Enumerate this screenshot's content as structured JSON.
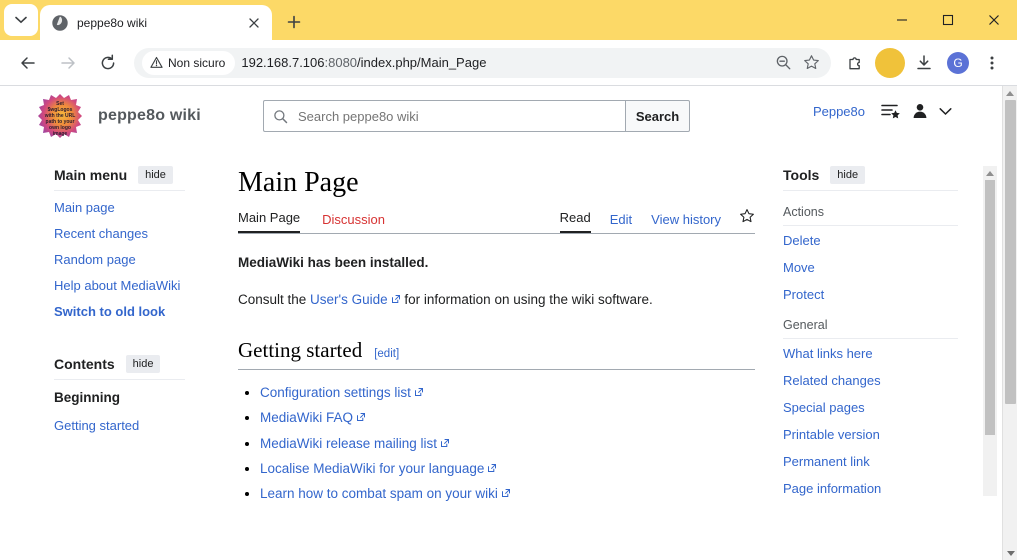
{
  "browser": {
    "tab": {
      "title": "peppe8o wiki",
      "favicon": "globe-icon",
      "close": "×"
    },
    "newtab_label": "+",
    "window_controls": {
      "minimize": "—",
      "maximize": "▢",
      "close": "✕"
    },
    "nav": {
      "back": "←",
      "forward": "→",
      "reload": "⟳"
    },
    "security_chip": {
      "label": "Non sicuro",
      "icon": "warning-triangle-icon"
    },
    "url": {
      "host": "192.168.7.106",
      "port": ":8080",
      "path": "/index.php/Main_Page"
    },
    "omnibox_actions": {
      "zoom": "zoom-out-icon",
      "bookmark": "star-icon"
    },
    "toolbar_actions": {
      "extensions": "puzzle-icon",
      "downloads": "download-icon",
      "profile_initial": "G",
      "menu": "three-dot-icon"
    }
  },
  "wiki": {
    "sitename": "peppe8o wiki",
    "logo_text": "Set $wgLogos with the URL path to your own logo image",
    "search": {
      "placeholder": "Search peppe8o wiki",
      "value": "",
      "button_label": "Search",
      "icon": "search-icon"
    },
    "user": {
      "name": "Peppe8o",
      "watchlist_icon": "watchlist-star-icon",
      "avatar_icon": "user-icon",
      "chevron_icon": "chevron-down-icon"
    },
    "main_menu": {
      "title": "Main menu",
      "hide_label": "hide",
      "items": [
        {
          "label": "Main page",
          "bold": false
        },
        {
          "label": "Recent changes",
          "bold": false
        },
        {
          "label": "Random page",
          "bold": false
        },
        {
          "label": "Help about MediaWiki",
          "bold": false
        },
        {
          "label": "Switch to old look",
          "bold": true
        }
      ]
    },
    "contents": {
      "title": "Contents",
      "hide_label": "hide",
      "current": "Beginning",
      "items": [
        {
          "label": "Getting started"
        }
      ]
    },
    "page": {
      "title": "Main Page",
      "namespace_tabs": [
        {
          "label": "Main Page",
          "state": "selected"
        },
        {
          "label": "Discussion",
          "state": "redlink"
        }
      ],
      "view_tabs": [
        {
          "label": "Read",
          "state": "selected"
        },
        {
          "label": "Edit",
          "state": "link"
        },
        {
          "label": "View history",
          "state": "link"
        }
      ],
      "watch_icon": "star-icon",
      "intro_bold": "MediaWiki has been installed.",
      "consult_prefix": "Consult the ",
      "consult_link": "User's Guide",
      "consult_suffix": " for information on using the wiki software.",
      "section_heading": "Getting started",
      "section_edit": "[edit]",
      "links": [
        "Configuration settings list",
        "MediaWiki FAQ",
        "MediaWiki release mailing list",
        "Localise MediaWiki for your language",
        "Learn how to combat spam on your wiki"
      ]
    },
    "tools": {
      "title": "Tools",
      "hide_label": "hide",
      "groups": [
        {
          "label": "Actions",
          "items": [
            "Delete",
            "Move",
            "Protect"
          ]
        },
        {
          "label": "General",
          "items": [
            "What links here",
            "Related changes",
            "Special pages",
            "Printable version",
            "Permanent link",
            "Page information"
          ]
        }
      ]
    }
  },
  "colors": {
    "tabstrip": "#fcd967",
    "link": "#3366cc",
    "redlink": "#d73333",
    "avatar": "#5b72d6"
  }
}
